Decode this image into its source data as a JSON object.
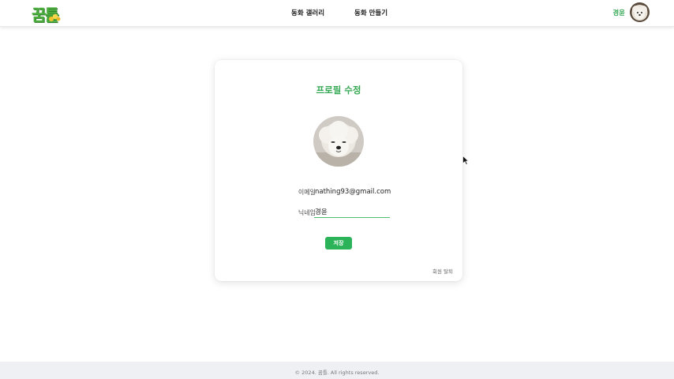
{
  "header": {
    "logo_text": "꿈틀",
    "nav": [
      {
        "label": "동화 갤러리"
      },
      {
        "label": "동화 만들기"
      }
    ],
    "user_name": "경윤"
  },
  "profile_edit": {
    "title": "프로필 수정",
    "email_label": "이메일",
    "email_value": "nathing93@gmail.com",
    "nickname_label": "닉네임",
    "nickname_value": "경윤",
    "save_label": "저장",
    "withdraw_label": "회원 탈퇴"
  },
  "footer": {
    "text": "© 2024. 꿈틀. All rights reserved."
  },
  "colors": {
    "brand_green": "#34a853",
    "button_green": "#2bb35a",
    "footer_bg": "#eef0f4"
  }
}
